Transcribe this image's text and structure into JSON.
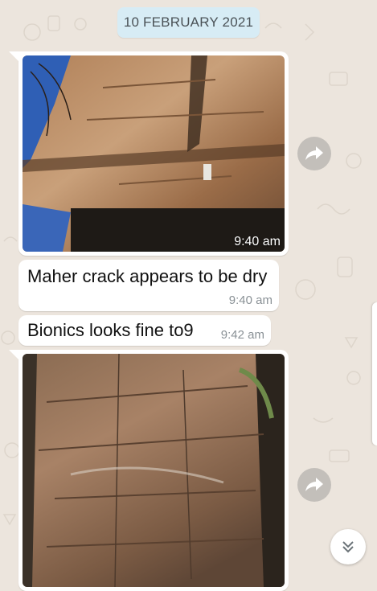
{
  "date_chip": {
    "label": "10 FEBRUARY 2021"
  },
  "messages": [
    {
      "type": "image",
      "time": "9:40 am",
      "icon": "rock-cliff-photo"
    },
    {
      "type": "text",
      "text": "Maher crack appears to be dry",
      "time": "9:40 am"
    },
    {
      "type": "text",
      "text": "Bionics looks fine to9",
      "time": "9:42 am"
    },
    {
      "type": "image",
      "time": "",
      "icon": "rock-face-photo"
    }
  ],
  "controls": {
    "forward_icon": "forward-arrow-icon",
    "scroll_down_icon": "double-chevron-down-icon"
  },
  "colors": {
    "wallpaper": "#ece5dd",
    "date_chip": "#d7ecf5",
    "bubble": "#ffffff"
  }
}
